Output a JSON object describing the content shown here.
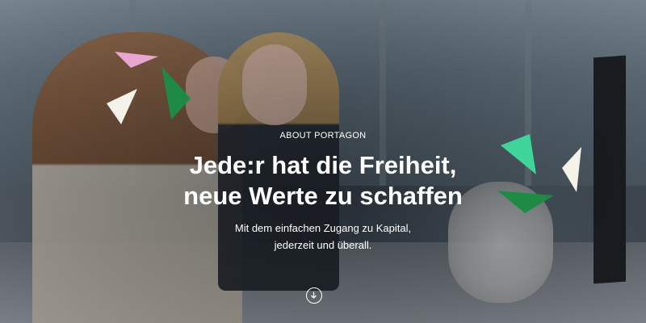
{
  "hero": {
    "eyebrow": "ABOUT PORTAGON",
    "headline_line1": "Jede:r hat die Freiheit,",
    "headline_line2": "neue Werte zu schaffen",
    "subline_line1": "Mit dem einfachen Zugang zu Kapital,",
    "subline_line2": "jederzeit und überall.",
    "scroll_icon": "arrow-down-circle-icon"
  },
  "colors": {
    "pink": "#e8a6d0",
    "dark_green": "#1f8a45",
    "mint_green": "#3fd59a",
    "white": "#f5f2ea",
    "text": "#ffffff"
  }
}
